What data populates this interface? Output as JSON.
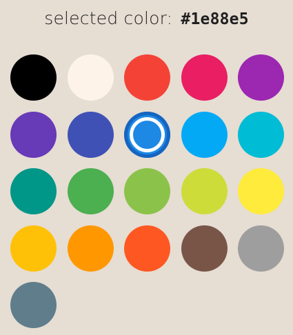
{
  "header": {
    "label": "selected color:",
    "value": "#1e88e5"
  },
  "selected_index": 7,
  "selected_ring_color": "#1565c0",
  "swatches": [
    {
      "color": "#000000",
      "name": "black"
    },
    {
      "color": "#fdf3e8",
      "name": "cream"
    },
    {
      "color": "#f44336",
      "name": "red"
    },
    {
      "color": "#e91e63",
      "name": "pink"
    },
    {
      "color": "#9c27b0",
      "name": "purple"
    },
    {
      "color": "#673ab7",
      "name": "deep-purple"
    },
    {
      "color": "#3f51b5",
      "name": "indigo"
    },
    {
      "color": "#1e88e5",
      "name": "blue"
    },
    {
      "color": "#03a9f4",
      "name": "light-blue"
    },
    {
      "color": "#00bcd4",
      "name": "cyan"
    },
    {
      "color": "#009688",
      "name": "teal"
    },
    {
      "color": "#4caf50",
      "name": "green"
    },
    {
      "color": "#8bc34a",
      "name": "light-green"
    },
    {
      "color": "#cddc39",
      "name": "lime"
    },
    {
      "color": "#ffeb3b",
      "name": "yellow"
    },
    {
      "color": "#ffc107",
      "name": "amber"
    },
    {
      "color": "#ff9800",
      "name": "orange"
    },
    {
      "color": "#ff5722",
      "name": "deep-orange"
    },
    {
      "color": "#795548",
      "name": "brown"
    },
    {
      "color": "#9e9e9e",
      "name": "grey"
    },
    {
      "color": "#607d8b",
      "name": "blue-grey"
    }
  ]
}
